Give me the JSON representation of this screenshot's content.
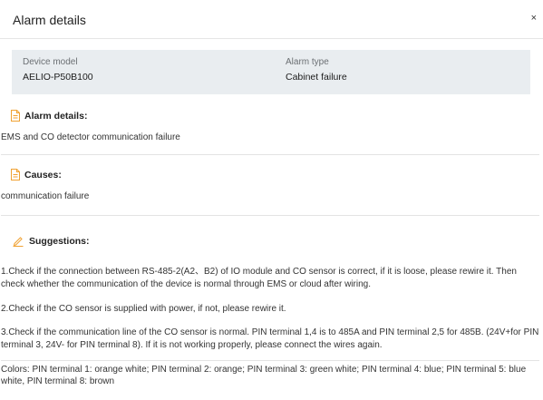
{
  "dialog": {
    "title": "Alarm details",
    "close_symbol": "×"
  },
  "info": {
    "device_model_label": "Device model",
    "device_model_value": "AELIO-P50B100",
    "alarm_type_label": "Alarm type",
    "alarm_type_value": "Cabinet failure"
  },
  "details": {
    "title": "Alarm details:",
    "icon": "document-icon",
    "text": "EMS and CO detector communication failure"
  },
  "causes": {
    "title": "Causes:",
    "icon": "document-icon",
    "text": "communication failure"
  },
  "suggestions": {
    "title": "Suggestions:",
    "icon": "edit-pencil-icon",
    "lines": [
      "1.Check if the connection between RS-485-2(A2、B2) of IO module and CO sensor is correct, if it is loose, please rewire it. Then check whether the communication of the device is normal through EMS or cloud after wiring.",
      "2.Check if the CO sensor is supplied with power, if not, please rewire it.",
      "3.Check if the communication line of the CO sensor is normal. PIN terminal 1,4 is to 485A and PIN terminal 2,5 for 485B. (24V+for PIN terminal 3, 24V- for PIN terminal 8). If it is not working properly, please connect the wires again.",
      "Colors: PIN terminal 1: orange white; PIN terminal 2: orange; PIN terminal 3: green white; PIN terminal 4: blue; PIN terminal 5: blue white, PIN terminal 8: brown"
    ]
  },
  "colors": {
    "accent_icon": "#f0a233",
    "info_background": "#e9edf0"
  }
}
